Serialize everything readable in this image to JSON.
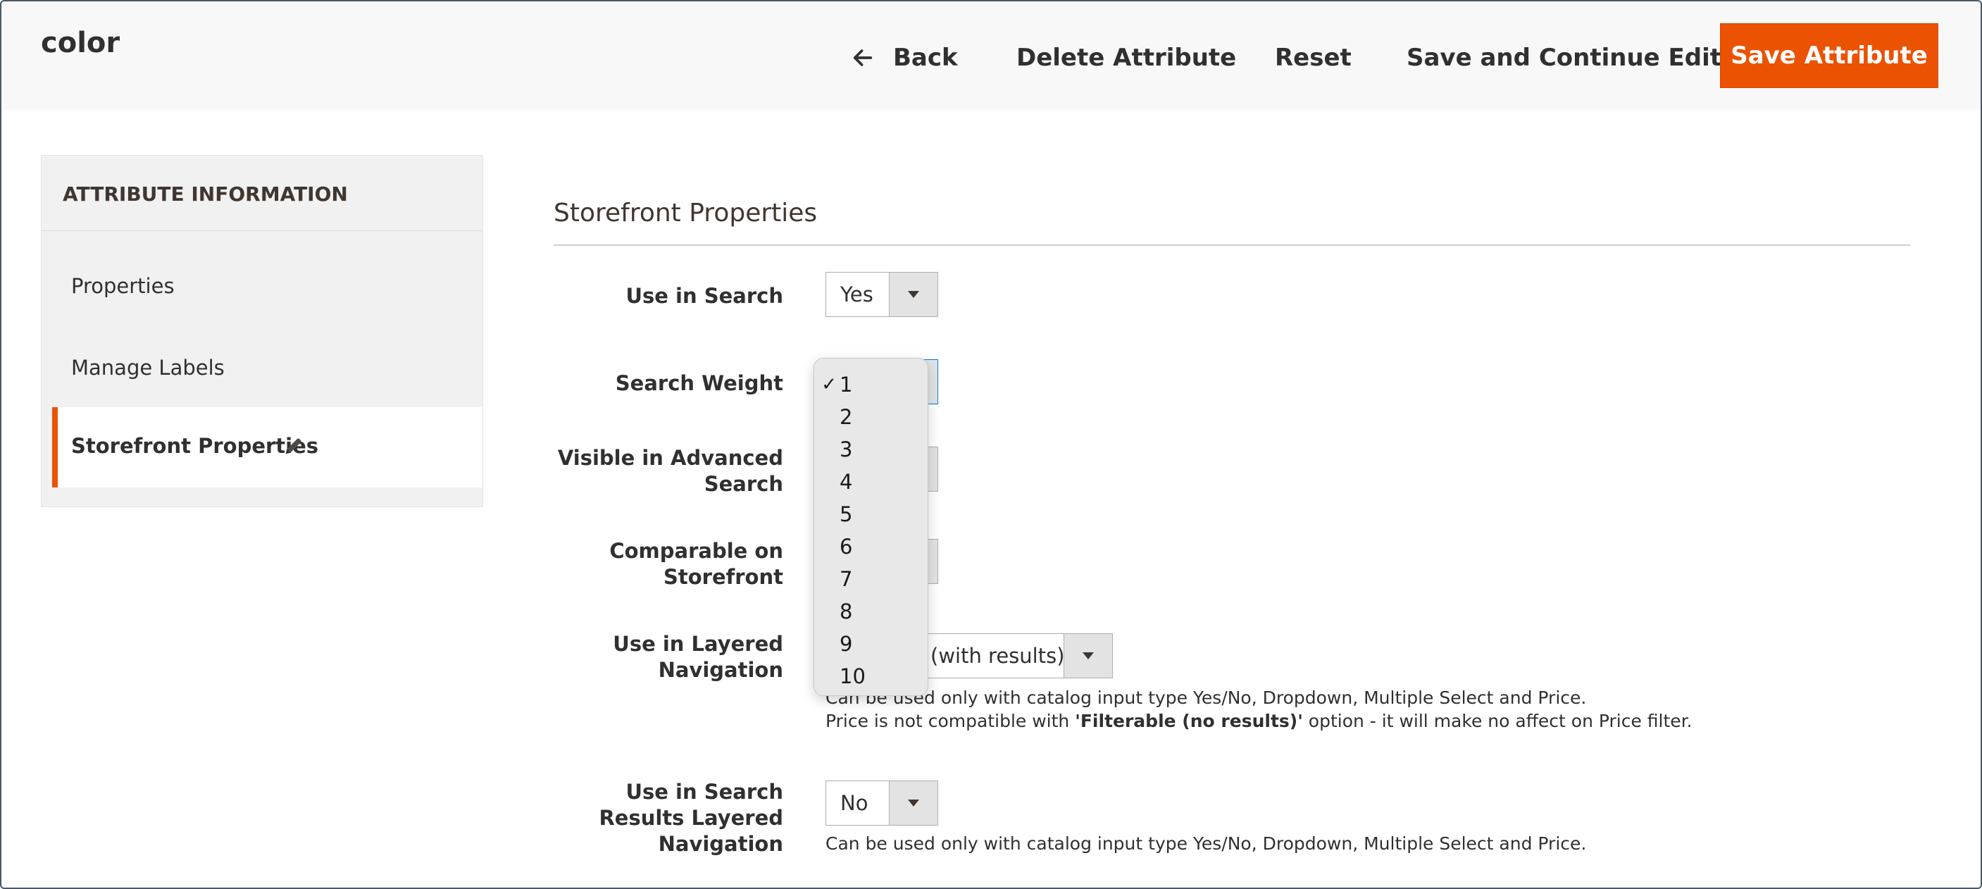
{
  "header": {
    "title": "color",
    "back_label": "Back",
    "delete_label": "Delete Attribute",
    "reset_label": "Reset",
    "save_continue_label": "Save and Continue Edit",
    "save_label": "Save Attribute"
  },
  "sidebar": {
    "title": "ATTRIBUTE INFORMATION",
    "items": [
      {
        "label": "Properties"
      },
      {
        "label": "Manage Labels"
      },
      {
        "label": "Storefront Properties",
        "active": true
      }
    ]
  },
  "main": {
    "section_title": "Storefront Properties",
    "fields": {
      "use_in_search": {
        "label": "Use in Search",
        "value": "Yes"
      },
      "search_weight": {
        "label": "Search Weight",
        "value": "1"
      },
      "visible_advanced": {
        "label_line1": "Visible in Advanced",
        "label_line2": "Search"
      },
      "comparable": {
        "label_line1": "Comparable on",
        "label_line2": "Storefront"
      },
      "layered_nav": {
        "label_line1": "Use in Layered",
        "label_line2": "Navigation",
        "value": "(with results)",
        "note_line1": "Can be used only with catalog input type Yes/No, Dropdown, Multiple Select and Price.",
        "note_line2_pre": "Price is not compatible with ",
        "note_line2_bold": "'Filterable (no results)'",
        "note_line2_post": " option - it will make no affect on Price filter."
      },
      "search_results_layered": {
        "label_line1": "Use in Search",
        "label_line2": "Results Layered",
        "label_line3": "Navigation",
        "value": "No",
        "note": "Can be used only with catalog input type Yes/No, Dropdown, Multiple Select and Price."
      }
    },
    "dropdown": {
      "check_mark": "✓",
      "options": [
        "1",
        "2",
        "3",
        "4",
        "5",
        "6",
        "7",
        "8",
        "9",
        "10"
      ],
      "selected": "1"
    }
  },
  "colors": {
    "accent": "#eb5202",
    "focus": "#007bdb"
  }
}
